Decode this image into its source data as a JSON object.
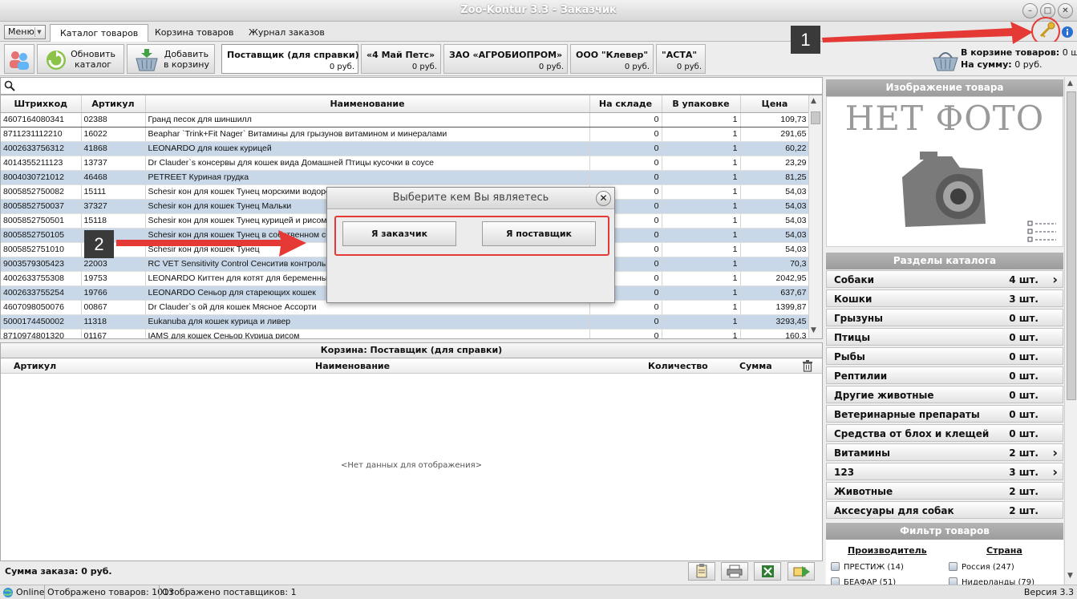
{
  "window": {
    "title": "Zoo-Kontur 3.3 - Заказчик"
  },
  "menu": {
    "label": "Меню"
  },
  "tabs": [
    "Каталог товаров",
    "Корзина товаров",
    "Журнал заказов"
  ],
  "toolbar": {
    "refresh_label_1": "Обновить",
    "refresh_label_2": "каталог",
    "add_label_1": "Добавить",
    "add_label_2": "в корзину"
  },
  "suppliers": [
    {
      "name": "Поставщик (для справки)",
      "sum": "0 руб."
    },
    {
      "name": "«4 Май Петс»",
      "sum": "0 руб."
    },
    {
      "name": "ЗАО «АГРОБИОПРОМ»",
      "sum": "0 руб."
    },
    {
      "name": "ООО \"Клевер\"",
      "sum": "0 руб."
    },
    {
      "name": "\"АСТА\"",
      "sum": "0 руб."
    }
  ],
  "cart_info": {
    "items_label": "В корзине товаров:",
    "items_value": "0 шт.",
    "sum_label": "На сумму:",
    "sum_value": "0 руб."
  },
  "catalog": {
    "columns": [
      "Штрихкод",
      "Артикул",
      "Наименование",
      "На складе",
      "В упаковке",
      "Цена"
    ],
    "rows": [
      [
        "4607164080341",
        "02388",
        "Гранд песок для шиншилл",
        "0",
        "1",
        "109,73"
      ],
      [
        "8711231112210",
        "16022",
        "Beaphar `Trink+Fit Nager` Витамины для грызунов витамином и минералами",
        "0",
        "1",
        "291,65"
      ],
      [
        "4002633756312",
        "41868",
        "LEONARDO для кошек курицей",
        "0",
        "1",
        "60,22"
      ],
      [
        "4014355211123",
        "13737",
        "Dr Clauder`s консервы для кошек вида Домашней Птицы кусочки в соусе",
        "0",
        "1",
        "23,29"
      ],
      [
        "8004030721012",
        "46468",
        "PETREET Куриная грудка",
        "0",
        "1",
        "81,25"
      ],
      [
        "8005852750082",
        "15111",
        "Schesir кон для кошек Тунец морскими водорослями",
        "0",
        "1",
        "54,03"
      ],
      [
        "8005852750037",
        "37327",
        "Schesir кон для кошек Тунец Мальки",
        "0",
        "1",
        "54,03"
      ],
      [
        "8005852750501",
        "15118",
        "Schesir кон для кошек Тунец курицей и рисом",
        "0",
        "1",
        "54,03"
      ],
      [
        "8005852750105",
        "15115",
        "Schesir кон для кошек Тунец в собственном соку",
        "0",
        "1",
        "54,03"
      ],
      [
        "8005852751010",
        "15113",
        "Schesir кон для кошек Тунец",
        "0",
        "1",
        "54,03"
      ],
      [
        "9003579305423",
        "22003",
        "RC VET Sensitivity Control Сенситив контроль",
        "0",
        "1",
        "70,3"
      ],
      [
        "4002633755308",
        "19753",
        "LEONARDO Киттен для котят для беременных кошек",
        "0",
        "1",
        "2042,95"
      ],
      [
        "4002633755254",
        "19766",
        "LEONARDO Сеньор для стареющих кошек",
        "0",
        "1",
        "637,67"
      ],
      [
        "4607098050076",
        "00867",
        "Dr Clauder`s ой для кошек Мясное Ассорти",
        "0",
        "1",
        "1399,87"
      ],
      [
        "5000174450002",
        "11318",
        "Eukanuba для кошек курица и ливер",
        "0",
        "1",
        "3293,45"
      ],
      [
        "8710974801320",
        "01167",
        "IAMS для кошек Сеньор Курица рисом",
        "0",
        "1",
        "160,3"
      ]
    ]
  },
  "cart": {
    "title": "Корзина: Поставщик (для справки)",
    "columns": [
      "Артикул",
      "Наименование",
      "Количество",
      "Сумма"
    ],
    "empty_text": "<Нет данных для отображения>",
    "order_sum": "Сумма заказа: 0 руб."
  },
  "status": {
    "online": "Online",
    "goods_shown": "Отображено товаров: 1013",
    "suppliers_shown": "Отображено поставщиков: 1",
    "version": "Версия 3.3"
  },
  "right_panel": {
    "image_header": "Изображение товара",
    "no_photo": "НЕТ ФОТО",
    "sections_header": "Разделы каталога",
    "categories": [
      {
        "name": "Собаки",
        "count": "4 шт.",
        "has_children": true
      },
      {
        "name": "Кошки",
        "count": "3 шт.",
        "has_children": false
      },
      {
        "name": "Грызуны",
        "count": "0 шт.",
        "has_children": false
      },
      {
        "name": "Птицы",
        "count": "0 шт.",
        "has_children": false
      },
      {
        "name": "Рыбы",
        "count": "0 шт.",
        "has_children": false
      },
      {
        "name": "Рептилии",
        "count": "0 шт.",
        "has_children": false
      },
      {
        "name": "Другие животные",
        "count": "0 шт.",
        "has_children": false
      },
      {
        "name": "Ветеринарные препараты",
        "count": "0 шт.",
        "has_children": false
      },
      {
        "name": "Средства от блох и клещей",
        "count": "0 шт.",
        "has_children": false
      },
      {
        "name": "Витамины",
        "count": "2 шт.",
        "has_children": true
      },
      {
        "name": "123",
        "count": "3 шт.",
        "has_children": true
      },
      {
        "name": "Животные",
        "count": "2 шт.",
        "has_children": false
      },
      {
        "name": "Аксесуары для собак",
        "count": "2 шт.",
        "has_children": false
      }
    ],
    "filter_header": "Фильтр товаров",
    "filter_producer_label": "Производитель",
    "filter_country_label": "Страна",
    "producers": [
      "ПРЕСТИЖ (14)",
      "БЕАФАР (51)"
    ],
    "countries": [
      "Россия (247)",
      "Нидерланды (79)"
    ]
  },
  "dialog": {
    "title": "Выберите кем Вы являетесь",
    "customer_button": "Я заказчик",
    "supplier_button": "Я поставщик"
  },
  "annotations": {
    "badge_1": "1",
    "badge_2": "2"
  },
  "colors": {
    "alt_row": "#c9d8e8",
    "highlight_red": "#e53935",
    "section_header": "#a6a6a6"
  }
}
